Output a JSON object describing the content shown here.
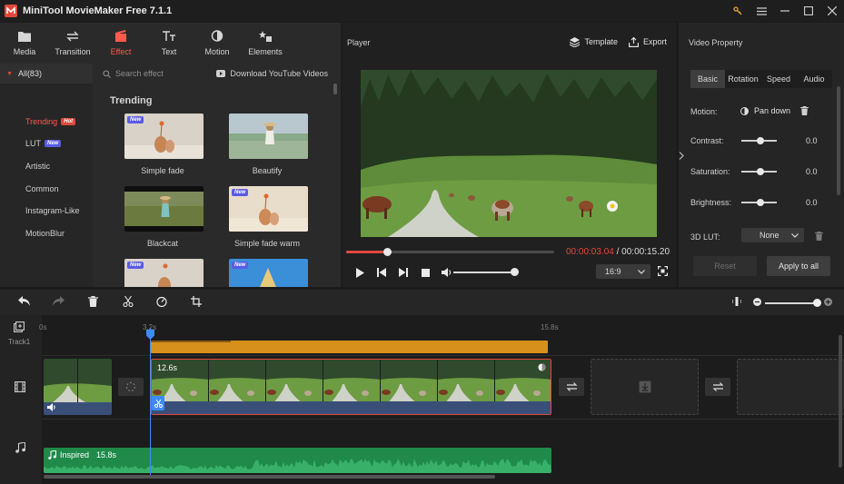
{
  "app": {
    "title": "MiniTool MovieMaker Free 7.1.1"
  },
  "media_toolbar": [
    {
      "label": "Media",
      "icon": "folder-icon"
    },
    {
      "label": "Transition",
      "icon": "transition-icon"
    },
    {
      "label": "Effect",
      "icon": "effect-icon",
      "active": true
    },
    {
      "label": "Text",
      "icon": "text-icon"
    },
    {
      "label": "Motion",
      "icon": "motion-icon"
    },
    {
      "label": "Elements",
      "icon": "elements-icon"
    }
  ],
  "categories": {
    "all_label": "All(83)",
    "items": [
      {
        "label": "Trending",
        "badge": "Hot",
        "active": true
      },
      {
        "label": "LUT",
        "badge": "New"
      },
      {
        "label": "Artistic"
      },
      {
        "label": "Common"
      },
      {
        "label": "Instagram-Like"
      },
      {
        "label": "MotionBlur"
      }
    ]
  },
  "effects": {
    "search_placeholder": "Search effect",
    "youtube_link": "Download YouTube Videos",
    "section_title": "Trending",
    "new_badge": "New",
    "items": [
      {
        "label": "Simple fade",
        "new": true
      },
      {
        "label": "Beautify",
        "new": false
      },
      {
        "label": "Blackcat",
        "new": false
      },
      {
        "label": "Simple fade warm",
        "new": true
      },
      {
        "label": "",
        "new": true
      },
      {
        "label": "",
        "new": true
      }
    ]
  },
  "player": {
    "label": "Player",
    "template_label": "Template",
    "export_label": "Export",
    "current_time": "00:00:03.04",
    "separator": " / ",
    "total_time": "00:00:15.20",
    "progress_fraction": 0.2,
    "volume_fraction": 1.0,
    "aspect_ratio": "16:9"
  },
  "properties": {
    "label": "Video Property",
    "tabs": [
      "Basic",
      "Rotation",
      "Speed",
      "Audio"
    ],
    "motion_label": "Motion:",
    "motion_value": "Pan down",
    "contrast_label": "Contrast:",
    "contrast_value": "0.0",
    "saturation_label": "Saturation:",
    "saturation_value": "0.0",
    "brightness_label": "Brightness:",
    "brightness_value": "0.0",
    "lut_label": "3D LUT:",
    "lut_value": "None",
    "reset_label": "Reset",
    "apply_label": "Apply to all"
  },
  "timeline": {
    "ruler_labels": [
      "0s",
      "3.2s",
      "15.8s"
    ],
    "track1_label": "Track1",
    "video_clip_duration": "12.6s",
    "audio_name": "Inspired",
    "audio_duration": "15.8s"
  },
  "colors": {
    "accent": "#e0483c",
    "playhead": "#3d8af7",
    "text_clip": "#d8901c",
    "audio_clip": "#1f8a4a"
  }
}
